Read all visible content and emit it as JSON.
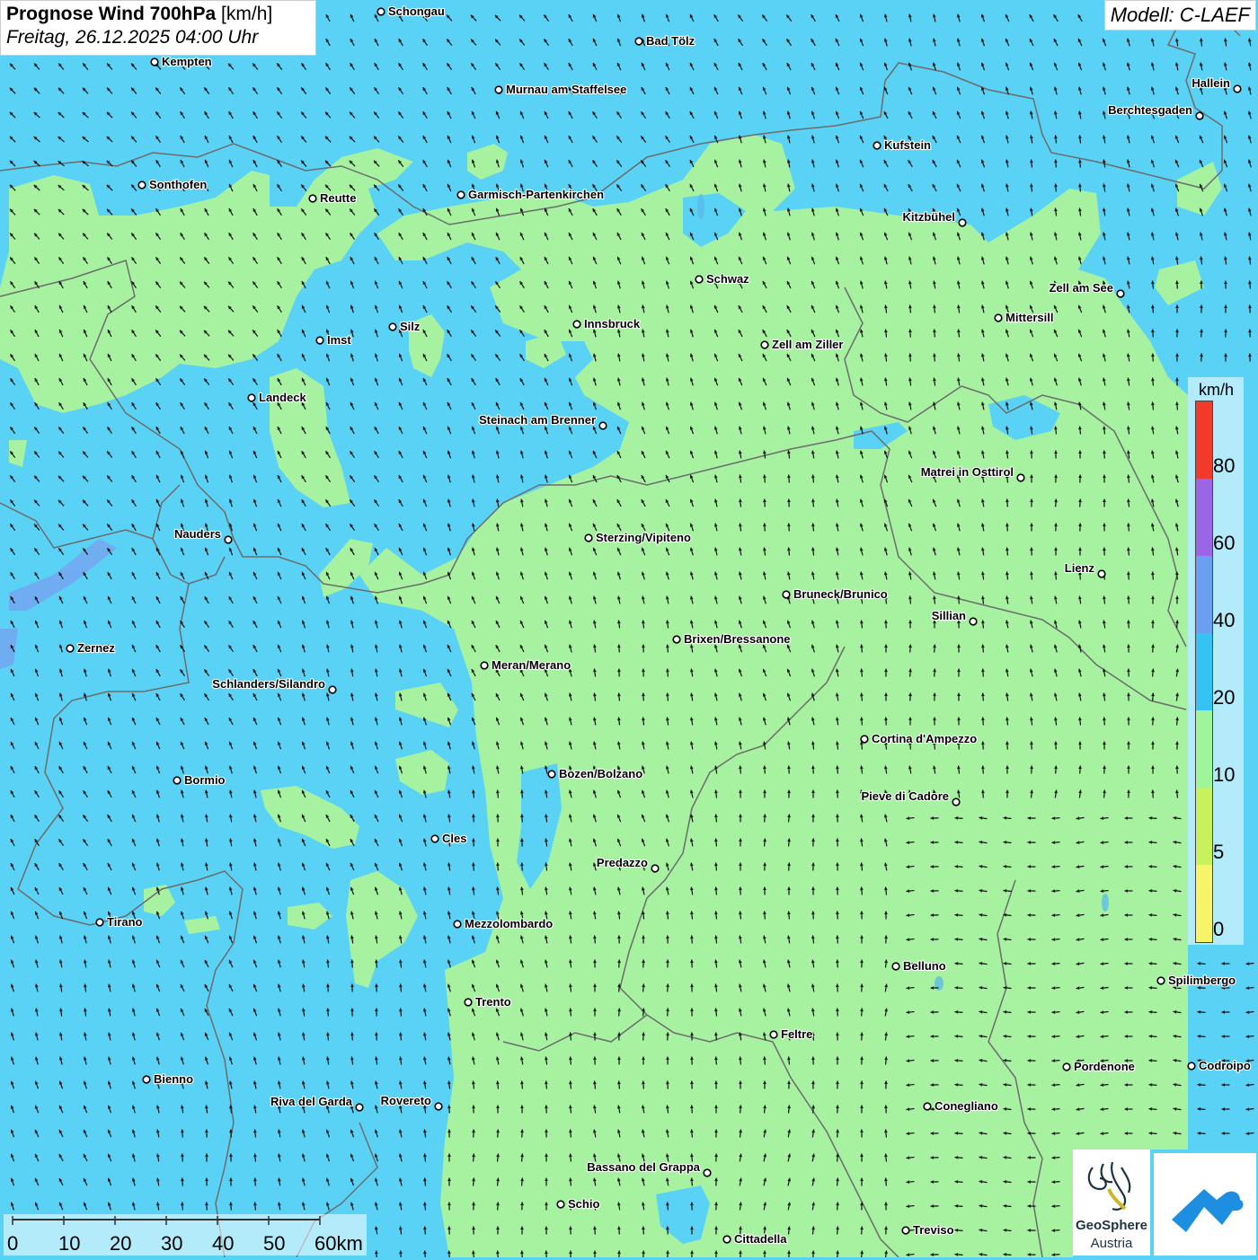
{
  "header": {
    "title_bold": "Prognose Wind 700hPa",
    "title_unit": "[km/h]",
    "datetime": "Freitag, 26.12.2025 04:00 Uhr",
    "model": "Modell: C-LAEF"
  },
  "legend": {
    "unit": "km/h",
    "labels": [
      "80",
      "60",
      "40",
      "20",
      "10",
      "5",
      "0"
    ],
    "colors": [
      "#f23a2a",
      "#9a66e6",
      "#6ba0f0",
      "#34c3f2",
      "#9ef59a",
      "#c9f15c",
      "#f8f46a"
    ]
  },
  "scale_bar": {
    "labels": [
      "0",
      "10",
      "20",
      "30",
      "40",
      "50",
      "60km"
    ]
  },
  "logos": {
    "geosphere_line1": "GeoSphere",
    "geosphere_line2": "Austria"
  },
  "colors": {
    "sea_blue": "#5ad2f5",
    "calm_green": "#a6f2a0",
    "border": "#6c6c6c",
    "arrow": "#111111"
  },
  "cities": [
    {
      "name": "Schongau"
    },
    {
      "name": "Bad Tölz"
    },
    {
      "name": "Kempten"
    },
    {
      "name": "Murnau am Staffelsee"
    },
    {
      "name": "Hallein"
    },
    {
      "name": "Berchtesgaden"
    },
    {
      "name": "Kufstein"
    },
    {
      "name": "Sonthofen"
    },
    {
      "name": "Reutte"
    },
    {
      "name": "Garmisch-Partenkirchen"
    },
    {
      "name": "Kitzbühel"
    },
    {
      "name": "Schwaz"
    },
    {
      "name": "Zell am See"
    },
    {
      "name": "Mittersill"
    },
    {
      "name": "Silz"
    },
    {
      "name": "Innsbruck"
    },
    {
      "name": "Imst"
    },
    {
      "name": "Zell am Ziller"
    },
    {
      "name": "Landeck"
    },
    {
      "name": "Steinach am Brenner"
    },
    {
      "name": "Matrei in Osttirol"
    },
    {
      "name": "Nauders"
    },
    {
      "name": "Sterzing/Vipiteno"
    },
    {
      "name": "Lienz"
    },
    {
      "name": "Bruneck/Brunico"
    },
    {
      "name": "Sillian"
    },
    {
      "name": "Zernez"
    },
    {
      "name": "Brixen/Bressanone"
    },
    {
      "name": "Meran/Merano"
    },
    {
      "name": "Schlanders/Silandro"
    },
    {
      "name": "Cortina d'Ampezzo"
    },
    {
      "name": "Bozen/Bolzano"
    },
    {
      "name": "Bormio"
    },
    {
      "name": "Pieve di Cadore"
    },
    {
      "name": "Cles"
    },
    {
      "name": "Predazzo"
    },
    {
      "name": "Tirano"
    },
    {
      "name": "Mezzolombardo"
    },
    {
      "name": "Belluno"
    },
    {
      "name": "Spilimbergo"
    },
    {
      "name": "Trento"
    },
    {
      "name": "Feltre"
    },
    {
      "name": "Pordenone"
    },
    {
      "name": "Codroipo"
    },
    {
      "name": "Bienno"
    },
    {
      "name": "Riva del Garda"
    },
    {
      "name": "Rovereto"
    },
    {
      "name": "Conegliano"
    },
    {
      "name": "Bassano del Grappa"
    },
    {
      "name": "Schio"
    },
    {
      "name": "Treviso"
    },
    {
      "name": "Cittadella"
    }
  ]
}
